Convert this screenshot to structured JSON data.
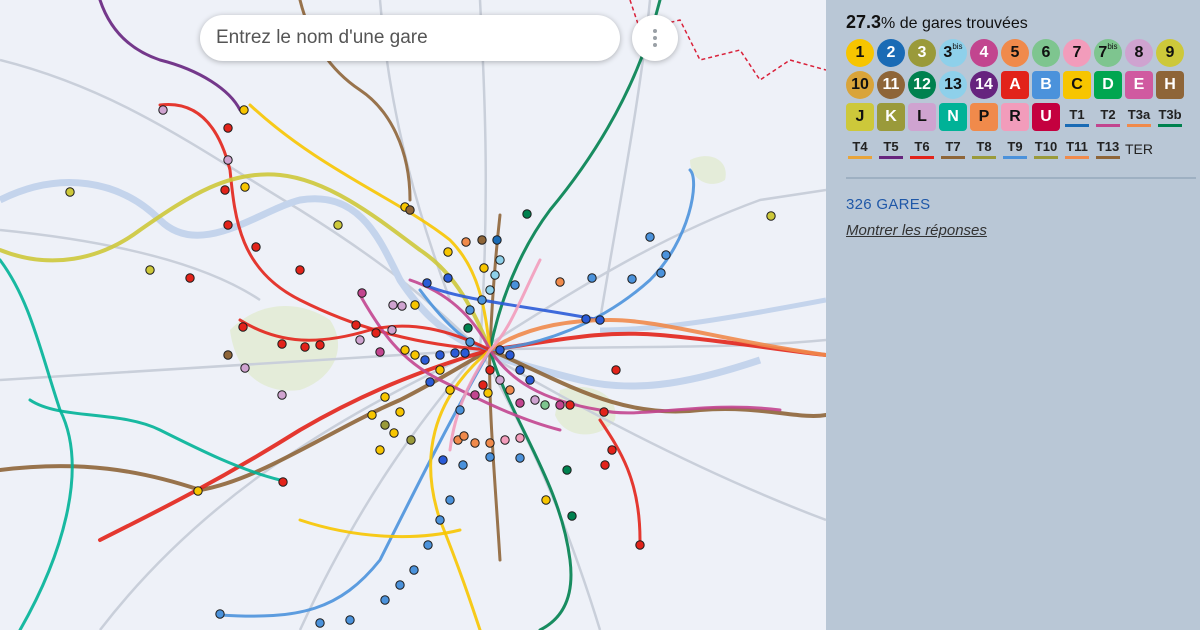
{
  "search": {
    "placeholder": "Entrez le nom d'une gare"
  },
  "progress": {
    "percent": "27.3",
    "suffix": "% de gares trouvées"
  },
  "stats": {
    "count_label": "326 GARES",
    "show_answers_label": "Montrer les réponses"
  },
  "lines": [
    [
      {
        "label": "1",
        "bg": "#f7c500",
        "fg": "#111",
        "shape": "circle"
      },
      {
        "label": "2",
        "bg": "#1a6bb5",
        "fg": "#fff",
        "shape": "circle"
      },
      {
        "label": "3",
        "bg": "#9a9a3a",
        "fg": "#fff",
        "shape": "circle"
      },
      {
        "label": "3",
        "sup": "bis",
        "bg": "#8ed0ea",
        "fg": "#111",
        "shape": "circle"
      },
      {
        "label": "4",
        "bg": "#c2458f",
        "fg": "#fff",
        "shape": "circle"
      },
      {
        "label": "5",
        "bg": "#f08a4b",
        "fg": "#111",
        "shape": "circle"
      },
      {
        "label": "6",
        "bg": "#7ec58f",
        "fg": "#111",
        "shape": "circle"
      },
      {
        "label": "7",
        "bg": "#f29cbb",
        "fg": "#111",
        "shape": "circle"
      },
      {
        "label": "7",
        "sup": "bis",
        "bg": "#7ec58f",
        "fg": "#111",
        "shape": "circle"
      },
      {
        "label": "8",
        "bg": "#cfa3d0",
        "fg": "#111",
        "shape": "circle"
      },
      {
        "label": "9",
        "bg": "#cdc83a",
        "fg": "#111",
        "shape": "circle"
      }
    ],
    [
      {
        "label": "10",
        "bg": "#d9a43a",
        "fg": "#111",
        "shape": "circle"
      },
      {
        "label": "11",
        "bg": "#8e6538",
        "fg": "#fff",
        "shape": "circle"
      },
      {
        "label": "12",
        "bg": "#00814f",
        "fg": "#fff",
        "shape": "circle"
      },
      {
        "label": "13",
        "bg": "#8ed0ea",
        "fg": "#111",
        "shape": "circle"
      },
      {
        "label": "14",
        "bg": "#66247e",
        "fg": "#fff",
        "shape": "circle"
      },
      {
        "label": "A",
        "bg": "#e2231a",
        "fg": "#fff",
        "shape": "square"
      },
      {
        "label": "B",
        "bg": "#4b92db",
        "fg": "#fff",
        "shape": "square"
      },
      {
        "label": "C",
        "bg": "#f7c500",
        "fg": "#111",
        "shape": "square"
      },
      {
        "label": "D",
        "bg": "#00a650",
        "fg": "#fff",
        "shape": "square"
      },
      {
        "label": "E",
        "bg": "#d05aa0",
        "fg": "#fff",
        "shape": "square"
      },
      {
        "label": "H",
        "bg": "#8e6538",
        "fg": "#fff",
        "shape": "square"
      }
    ],
    [
      {
        "label": "J",
        "bg": "#cdc83a",
        "fg": "#111",
        "shape": "square"
      },
      {
        "label": "K",
        "bg": "#9a9a3a",
        "fg": "#fff",
        "shape": "square"
      },
      {
        "label": "L",
        "bg": "#cfa3d0",
        "fg": "#111",
        "shape": "square"
      },
      {
        "label": "N",
        "bg": "#00b297",
        "fg": "#fff",
        "shape": "square"
      },
      {
        "label": "P",
        "bg": "#f08a4b",
        "fg": "#111",
        "shape": "square"
      },
      {
        "label": "R",
        "bg": "#f29cbb",
        "fg": "#111",
        "shape": "square"
      },
      {
        "label": "U",
        "bg": "#c4003f",
        "fg": "#fff",
        "shape": "square"
      },
      {
        "label": "T1",
        "bar": "#1a6bb5",
        "shape": "tram"
      },
      {
        "label": "T2",
        "bar": "#c2458f",
        "shape": "tram"
      },
      {
        "label": "T3a",
        "bar": "#f08a4b",
        "shape": "tram"
      },
      {
        "label": "T3b",
        "bar": "#00814f",
        "shape": "tram"
      }
    ],
    [
      {
        "label": "T4",
        "bar": "#e8a43a",
        "shape": "tram"
      },
      {
        "label": "T5",
        "bar": "#66247e",
        "shape": "tram"
      },
      {
        "label": "T6",
        "bar": "#e2231a",
        "shape": "tram"
      },
      {
        "label": "T7",
        "bar": "#8e6538",
        "shape": "tram"
      },
      {
        "label": "T8",
        "bar": "#9a9a3a",
        "shape": "tram"
      },
      {
        "label": "T9",
        "bar": "#4b92db",
        "shape": "tram"
      },
      {
        "label": "T10",
        "bar": "#9a9a3a",
        "shape": "tram"
      },
      {
        "label": "T11",
        "bar": "#f08a4b",
        "shape": "tram"
      },
      {
        "label": "T13",
        "bar": "#8e6538",
        "shape": "tram"
      },
      {
        "label": "TER",
        "bar": "",
        "shape": "ter"
      }
    ]
  ],
  "map": {
    "icons": [
      "more-vert-icon"
    ],
    "line_colors": [
      "#e2231a",
      "#f7c500",
      "#4b92db",
      "#00814f",
      "#8e6538",
      "#00a650",
      "#c2458f",
      "#9a9a3a",
      "#2a5bd7",
      "#00b297",
      "#f08a4b",
      "#cfa3d0",
      "#1a6bb5",
      "#f29cbb",
      "#66247e",
      "#cdc83a"
    ]
  }
}
